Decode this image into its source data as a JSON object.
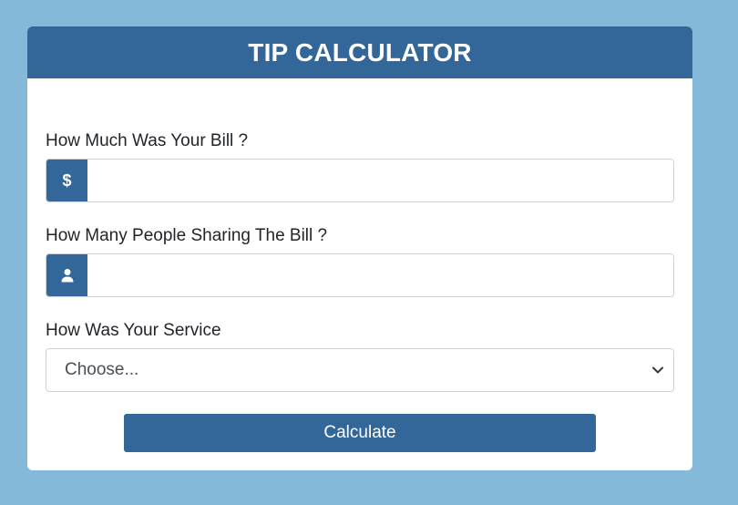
{
  "header": {
    "title": "TIP CALCULATOR"
  },
  "bill": {
    "label": "How Much Was Your Bill ?",
    "addon_symbol": "$",
    "value": "",
    "placeholder": ""
  },
  "people": {
    "label": "How Many People Sharing The Bill ?",
    "addon_icon": "user-icon",
    "value": "",
    "placeholder": ""
  },
  "service": {
    "label": "How Was Your Service",
    "selected": "Choose...",
    "chevron_icon": "chevron-down-icon"
  },
  "calculate": {
    "label": "Calculate"
  },
  "colors": {
    "page_background": "#85b9d9",
    "accent": "#336699",
    "card": "#ffffff"
  }
}
